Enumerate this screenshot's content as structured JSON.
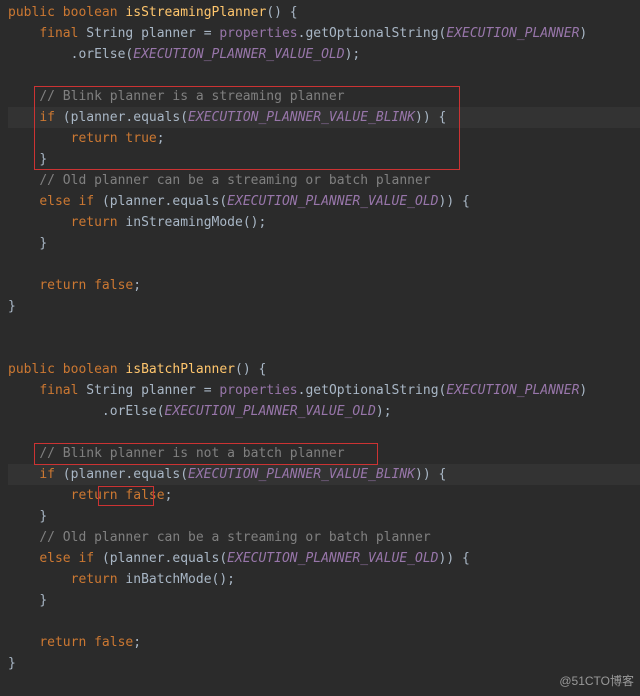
{
  "code": {
    "l1_kw1": "public ",
    "l1_kw2": "boolean ",
    "l1_method": "isStreamingPlanner",
    "l1_tail": "() {",
    "l2_kw": "final ",
    "l2_type": "String ",
    "l2_var": "planner = ",
    "l2_field": "properties",
    "l2_call": ".getOptionalString(",
    "l2_param": "EXECUTION_PLANNER",
    "l2_tail": ")",
    "l3_call": ".orElse(",
    "l3_param": "EXECUTION_PLANNER_VALUE_OLD",
    "l3_tail": ");",
    "l4_comment": "// Blink planner is a streaming planner",
    "l5_kw": "if ",
    "l5_open": "(planner.equals(",
    "l5_param": "EXECUTION_PLANNER_VALUE_BLINK",
    "l5_tail": ")) {",
    "l6_kw": "return ",
    "l6_val": "true",
    "l6_tail": ";",
    "l7": "}",
    "l8_comment": "// Old planner can be a streaming or batch planner",
    "l9_kw": "else if ",
    "l9_open": "(planner.equals(",
    "l9_param": "EXECUTION_PLANNER_VALUE_OLD",
    "l9_tail": ")) {",
    "l10_kw": "return ",
    "l10_call": "inStreamingMode();",
    "l11": "}",
    "l12_kw": "return ",
    "l12_val": "false",
    "l12_tail": ";",
    "l13": "}",
    "m1_kw1": "public ",
    "m1_kw2": "boolean ",
    "m1_method": "isBatchPlanner",
    "m1_tail": "() {",
    "m2_kw": "final ",
    "m2_type": "String ",
    "m2_var": "planner = ",
    "m2_field": "properties",
    "m2_call": ".getOptionalString(",
    "m2_param": "EXECUTION_PLANNER",
    "m2_tail": ")",
    "m3_call": ".orElse(",
    "m3_param": "EXECUTION_PLANNER_VALUE_OLD",
    "m3_tail": ");",
    "m4_comment": "// Blink planner is not a batch planner",
    "m5_kw": "if ",
    "m5_open": "(planner.equals(",
    "m5_param": "EXECUTION_PLANNER_VALUE_BLINK",
    "m5_tail": ")) {",
    "m6_kw": "return ",
    "m6_val": "false",
    "m6_tail": ";",
    "m7": "}",
    "m8_comment": "// Old planner can be a streaming or batch planner",
    "m9_kw": "else if ",
    "m9_open": "(planner.equals(",
    "m9_param": "EXECUTION_PLANNER_VALUE_OLD",
    "m9_tail": ")) {",
    "m10_kw": "return ",
    "m10_call": "inBatchMode();",
    "m11": "}",
    "m12_kw": "return ",
    "m12_val": "false",
    "m12_tail": ";",
    "m13": "}"
  },
  "watermark": "@51CTO博客"
}
